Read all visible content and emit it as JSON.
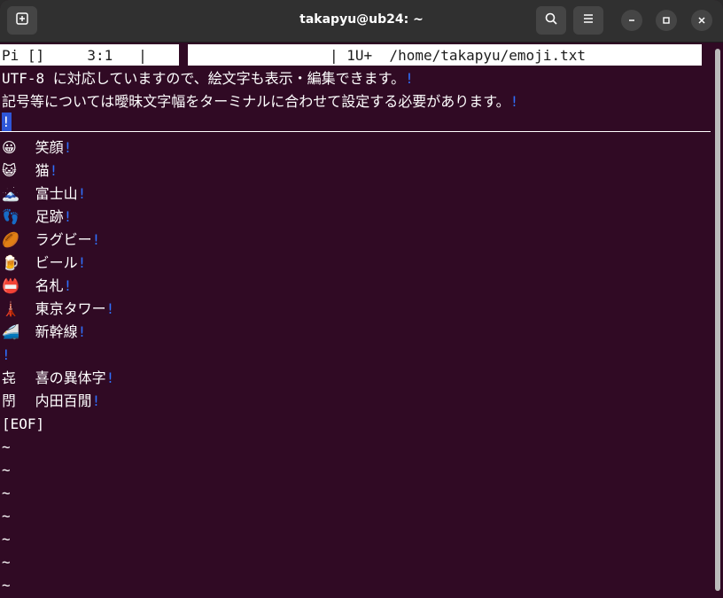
{
  "window": {
    "title": "takapyu@ub24: ~"
  },
  "status": {
    "left": "Pi []     3:1   |",
    "right": "| 1U+  /home/takapyu/emoji.txt"
  },
  "text": {
    "line1": "UTF-8 に対応していますので、絵文字も表示・編集できます。",
    "line2": "記号等については曖昧文字幅をターミナルに合わせて設定する必要があります。",
    "line_end_mark": "!"
  },
  "entries": [
    {
      "icon": "😀",
      "text": "笑顔"
    },
    {
      "icon": "😺",
      "text": "猫"
    },
    {
      "icon": "🗻",
      "text": "富士山"
    },
    {
      "icon": "👣",
      "text": "足跡"
    },
    {
      "icon": "🏉",
      "text": "ラグビー"
    },
    {
      "icon": "🍺",
      "text": "ビール"
    },
    {
      "icon": "📛",
      "text": "名札"
    },
    {
      "icon": "🗼",
      "text": "東京タワー"
    },
    {
      "icon": "🚄",
      "text": "新幹線"
    }
  ],
  "kanji_entries": [
    {
      "icon": "㐂",
      "text": "喜の異体字"
    },
    {
      "icon": "閅",
      "text": "内田百閒"
    }
  ],
  "eof": "[EOF]",
  "tilde": "~",
  "colors": {
    "background": "#300a24",
    "line_end_mark": "#2f70ff",
    "cursor": "#2e56d8",
    "status_bar": "#ffffff"
  }
}
